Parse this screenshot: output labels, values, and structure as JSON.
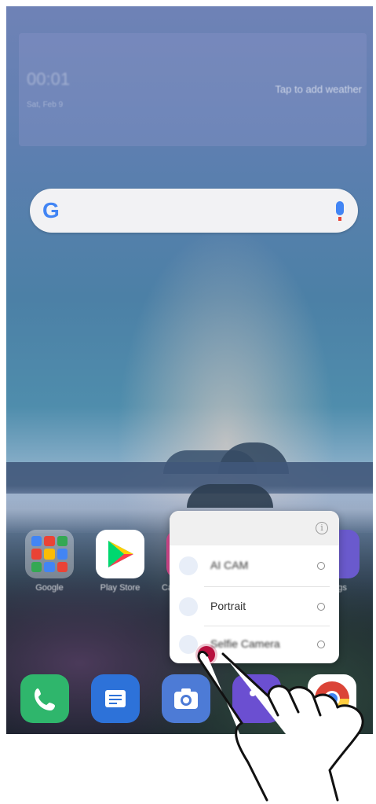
{
  "weather_widget": {
    "time": "00:01",
    "date": "Sat, Feb 9",
    "tap_label": "Tap to add weather"
  },
  "search": {
    "logo": "G",
    "icon_left": "google-logo-icon",
    "icon_right": "microphone-icon"
  },
  "apps": [
    {
      "label": "Google",
      "icon": "google-folder-icon"
    },
    {
      "label": "Play Store",
      "icon": "play-store-icon"
    },
    {
      "label": "Ca",
      "icon": "camera-app-icon"
    },
    {
      "label": "ngs",
      "icon": "settings-icon"
    }
  ],
  "dock": [
    {
      "icon": "phone-icon"
    },
    {
      "icon": "messages-icon"
    },
    {
      "icon": "camera-icon"
    },
    {
      "icon": "app-icon"
    },
    {
      "icon": "chrome-icon"
    }
  ],
  "popup": {
    "info_icon": "i",
    "items": [
      {
        "label": "AI CAM"
      },
      {
        "label": "Portrait"
      },
      {
        "label": "Selfie Camera"
      }
    ]
  },
  "colors": {
    "tap_indicator": "#b8103e",
    "popup_bg": "#ffffff"
  }
}
